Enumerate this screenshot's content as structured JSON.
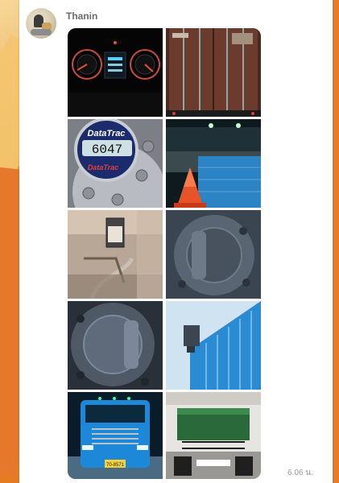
{
  "message": {
    "sender_name": "Thanin",
    "timestamp": "6.06 น.",
    "photos": [
      {
        "subject": "dashboard-gauges"
      },
      {
        "subject": "container-doors"
      },
      {
        "subject": "datatrac-hubodometer",
        "brand": "DataTrac",
        "reading": "6047"
      },
      {
        "subject": "flatbed-cones"
      },
      {
        "subject": "engine-filter"
      },
      {
        "subject": "gray-hub-cap"
      },
      {
        "subject": "hub-cap-wheel"
      },
      {
        "subject": "blue-container-side"
      },
      {
        "subject": "truck-front",
        "plate": "70-8571"
      },
      {
        "subject": "truck-rear-underside"
      }
    ]
  },
  "colors": {
    "accent_orange": "#e97c25",
    "truck_blue": "#1e88d8",
    "container_brown": "#6b3b2e"
  }
}
